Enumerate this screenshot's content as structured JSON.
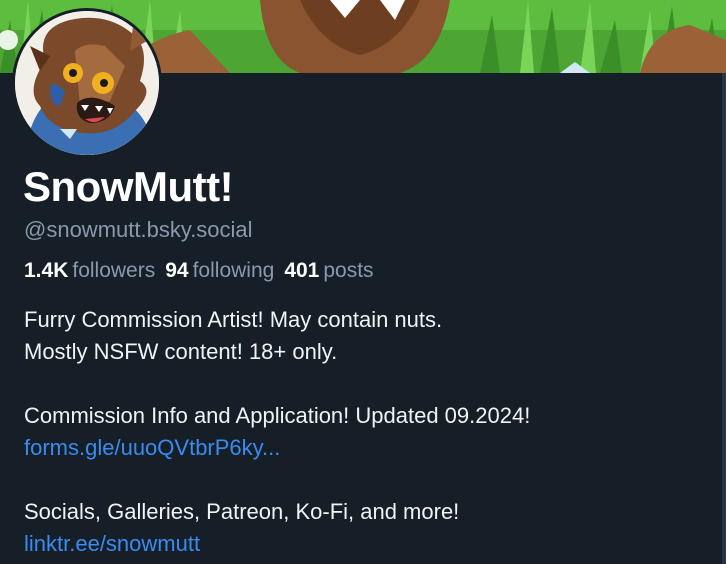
{
  "profile": {
    "display_name": "SnowMutt!",
    "handle": "@snowmutt.bsky.social",
    "stats": {
      "followers_count": "1.4K",
      "followers_label": "followers",
      "following_count": "94",
      "following_label": "following",
      "posts_count": "401",
      "posts_label": "posts"
    },
    "bio": {
      "line1": "Furry Commission Artist! May contain nuts.",
      "line2": "Mostly NSFW content! 18+ only.",
      "line3": "Commission Info and Application! Updated 09.2024!",
      "link1": "forms.gle/uuoQVtbrP6ky...",
      "line4": "Socials, Galleries, Patreon, Ko-Fi, and more!",
      "link2": "linktr.ee/snowmutt"
    }
  },
  "colors": {
    "background": "#161e27",
    "text_primary": "#ffffff",
    "text_secondary": "#8a99ad",
    "link": "#3a8bf0",
    "banner_grass": "#4aa832",
    "avatar_fur": "#7a4a2a"
  },
  "icons": {
    "banner": "banner-illustration",
    "avatar": "avatar-illustration"
  }
}
